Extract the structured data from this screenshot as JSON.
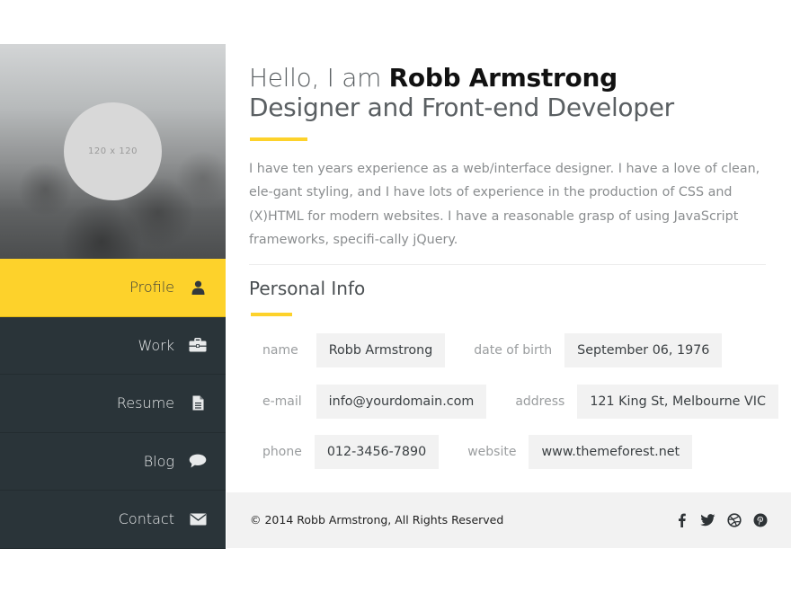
{
  "profile": {
    "avatar_placeholder": "120 x 120",
    "greeting_prefix": "Hello, I am ",
    "name": "Robb Armstrong",
    "role": "Designer and Front-end Developer",
    "intro": "I have ten years experience as a web/interface designer. I have a love of clean, ele-gant styling, and I have lots of experience in the production of CSS and (X)HTML for modern websites. I have a reasonable grasp of using JavaScript frameworks, specifi-cally jQuery."
  },
  "nav": {
    "items": [
      {
        "label": "Profile",
        "icon": "user-icon",
        "active": true
      },
      {
        "label": "Work",
        "icon": "briefcase-icon",
        "active": false
      },
      {
        "label": "Resume",
        "icon": "document-icon",
        "active": false
      },
      {
        "label": "Blog",
        "icon": "speech-bubble-icon",
        "active": false
      },
      {
        "label": "Contact",
        "icon": "envelope-icon",
        "active": false
      }
    ]
  },
  "personal_info": {
    "title": "Personal Info",
    "fields": [
      {
        "label": "name",
        "value": "Robb Armstrong"
      },
      {
        "label": "date of birth",
        "value": "September 06, 1976"
      },
      {
        "label": "e-mail",
        "value": "info@yourdomain.com"
      },
      {
        "label": "address",
        "value": "121 King St, Melbourne VIC"
      },
      {
        "label": "phone",
        "value": "012-3456-7890"
      },
      {
        "label": "website",
        "value": "www.themeforest.net"
      }
    ]
  },
  "footer": {
    "copyright": "© 2014 Robb Armstrong,  All Rights Reserved",
    "social": [
      "facebook-icon",
      "twitter-icon",
      "dribbble-icon",
      "pinterest-icon"
    ]
  },
  "colors": {
    "accent": "#fdd22b",
    "sidebar": "#2a3439",
    "footer": "#f2f2f2"
  }
}
